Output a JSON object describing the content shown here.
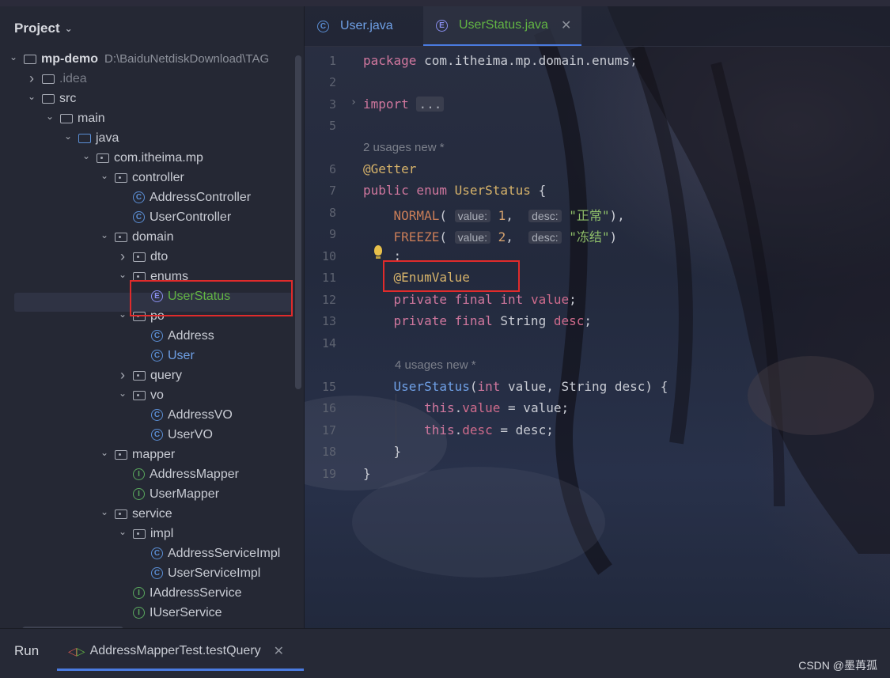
{
  "sidebar": {
    "title": "Project",
    "tree": [
      {
        "label": "mp-demo",
        "extra": "D:\\BaiduNetdiskDownload\\TAG",
        "depth": 0,
        "arrow": "open",
        "icon": "module",
        "style": "bold"
      },
      {
        "label": ".idea",
        "depth": 1,
        "arrow": "closed",
        "icon": "folder",
        "style": "dim"
      },
      {
        "label": "src",
        "depth": 1,
        "arrow": "open",
        "icon": "folder"
      },
      {
        "label": "main",
        "depth": 2,
        "arrow": "open",
        "icon": "folder"
      },
      {
        "label": "java",
        "depth": 3,
        "arrow": "open",
        "icon": "folder-blue"
      },
      {
        "label": "com.itheima.mp",
        "depth": 4,
        "arrow": "open",
        "icon": "package"
      },
      {
        "label": "controller",
        "depth": 5,
        "arrow": "open",
        "icon": "package"
      },
      {
        "label": "AddressController",
        "depth": 6,
        "icon": "class"
      },
      {
        "label": "UserController",
        "depth": 6,
        "icon": "class"
      },
      {
        "label": "domain",
        "depth": 5,
        "arrow": "open",
        "icon": "package"
      },
      {
        "label": "dto",
        "depth": 6,
        "arrow": "closed",
        "icon": "package"
      },
      {
        "label": "enums",
        "depth": 6,
        "arrow": "open",
        "icon": "package"
      },
      {
        "label": "UserStatus",
        "depth": 7,
        "icon": "enum",
        "style": "green"
      },
      {
        "label": "po",
        "depth": 6,
        "arrow": "open",
        "icon": "package"
      },
      {
        "label": "Address",
        "depth": 7,
        "icon": "class"
      },
      {
        "label": "User",
        "depth": 7,
        "icon": "class",
        "style": "blue"
      },
      {
        "label": "query",
        "depth": 6,
        "arrow": "closed",
        "icon": "package"
      },
      {
        "label": "vo",
        "depth": 6,
        "arrow": "open",
        "icon": "package"
      },
      {
        "label": "AddressVO",
        "depth": 7,
        "icon": "class"
      },
      {
        "label": "UserVO",
        "depth": 7,
        "icon": "class"
      },
      {
        "label": "mapper",
        "depth": 5,
        "arrow": "open",
        "icon": "package"
      },
      {
        "label": "AddressMapper",
        "depth": 6,
        "icon": "interface"
      },
      {
        "label": "UserMapper",
        "depth": 6,
        "icon": "interface"
      },
      {
        "label": "service",
        "depth": 5,
        "arrow": "open",
        "icon": "package"
      },
      {
        "label": "impl",
        "depth": 6,
        "arrow": "open",
        "icon": "package"
      },
      {
        "label": "AddressServiceImpl",
        "depth": 7,
        "icon": "class"
      },
      {
        "label": "UserServiceImpl",
        "depth": 7,
        "icon": "class"
      },
      {
        "label": "IAddressService",
        "depth": 6,
        "icon": "interface"
      },
      {
        "label": "IUserService",
        "depth": 6,
        "icon": "interface"
      }
    ]
  },
  "tabs": [
    {
      "label": "User.java",
      "icon": "class",
      "active": false
    },
    {
      "label": "UserStatus.java",
      "icon": "enum",
      "active": true
    }
  ],
  "editor": {
    "hint1": "2 usages   new *",
    "hint2": "4 usages   new *",
    "lines": [
      "1",
      "2",
      "3",
      "5",
      "6",
      "7",
      "8",
      "9",
      "10",
      "11",
      "12",
      "13",
      "14",
      "15",
      "16",
      "17",
      "18",
      "19"
    ]
  },
  "bottom": {
    "run_label": "Run",
    "run_tab": "AddressMapperTest.testQuery",
    "watermark": "CSDN @墨苒孤"
  },
  "colors": {
    "accent": "#4a7be0",
    "highlight_box": "#e02b2b",
    "enum_green": "#62b543"
  }
}
